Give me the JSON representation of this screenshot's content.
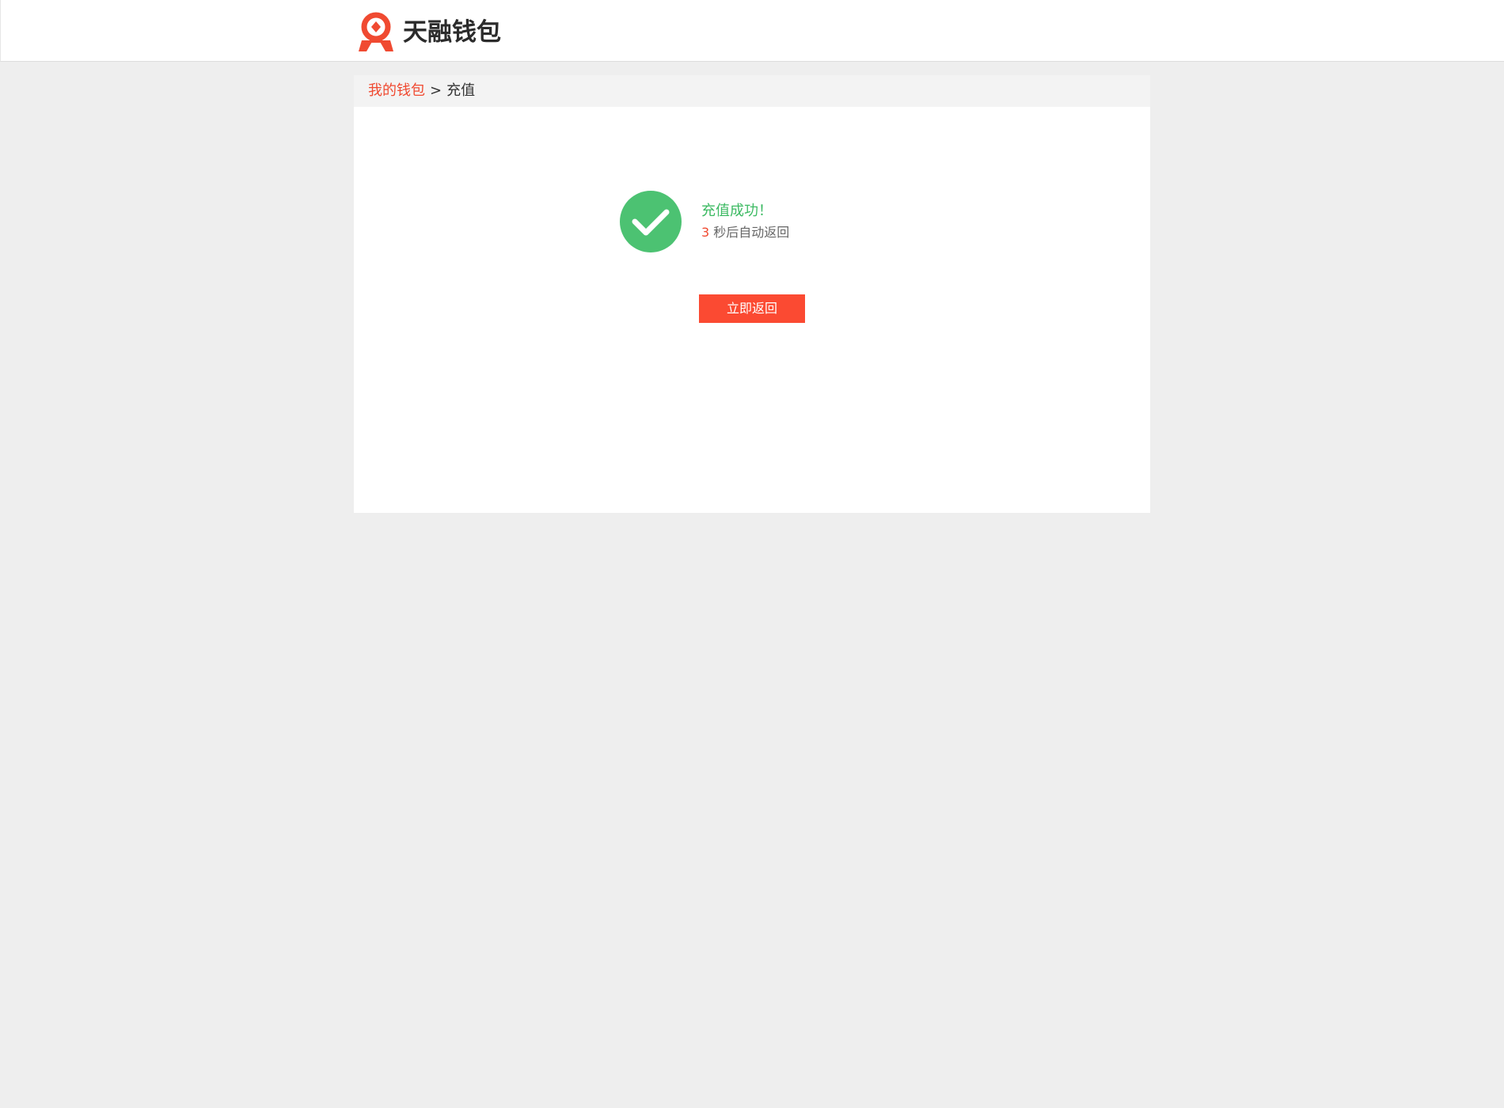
{
  "header": {
    "brand_name": "天融钱包",
    "brand_color": "#f04a31",
    "logo_icon": "wallet-logo-icon"
  },
  "breadcrumb": {
    "link_label": "我的钱包",
    "separator": ">",
    "current_label": "充值"
  },
  "result": {
    "icon": "success-check-icon",
    "icon_color": "#4cc272",
    "title": "充值成功！",
    "countdown_number": "3",
    "countdown_text": "秒后自动返回"
  },
  "actions": {
    "return_now_label": "立即返回",
    "button_color": "#fb4a32"
  }
}
